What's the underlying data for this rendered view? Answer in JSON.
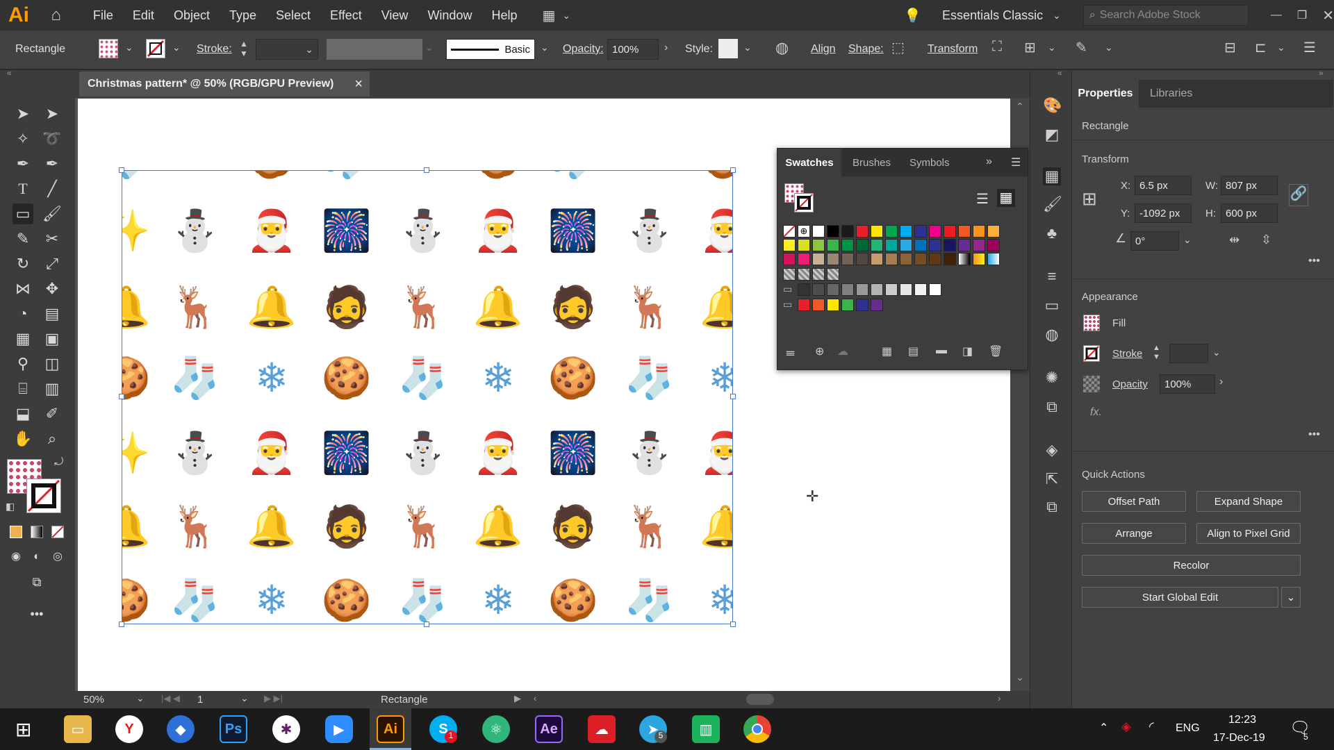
{
  "app": {
    "logo": "Ai"
  },
  "menu": [
    "File",
    "Edit",
    "Object",
    "Type",
    "Select",
    "Effect",
    "View",
    "Window",
    "Help"
  ],
  "workspace": "Essentials Classic",
  "search_placeholder": "Search Adobe Stock",
  "control": {
    "object_type": "Rectangle",
    "stroke_label": "Stroke:",
    "brush": "Basic",
    "opacity_label": "Opacity:",
    "opacity_value": "100%",
    "style_label": "Style:",
    "align": "Align",
    "shape": "Shape:",
    "transform": "Transform"
  },
  "document": {
    "tab_title": "Christmas pattern* @ 50% (RGB/GPU Preview)",
    "close": "×"
  },
  "status": {
    "zoom": "50%",
    "page": "1",
    "tool": "Rectangle"
  },
  "swatches_panel": {
    "tabs": [
      "Swatches",
      "Brushes",
      "Symbols"
    ]
  },
  "properties": {
    "tabs": [
      "Properties",
      "Libraries"
    ],
    "object": "Rectangle",
    "transform_title": "Transform",
    "x_label": "X:",
    "x": "6.5 px",
    "y_label": "Y:",
    "y": "-1092 px",
    "w_label": "W:",
    "w": "807 px",
    "h_label": "H:",
    "h": "600 px",
    "angle": "0°",
    "appearance_title": "Appearance",
    "fill": "Fill",
    "stroke": "Stroke",
    "opacity_label": "Opacity",
    "opacity": "100%",
    "fx": "fx.",
    "quick_actions_title": "Quick Actions",
    "offset_path": "Offset Path",
    "expand_shape": "Expand Shape",
    "arrange": "Arrange",
    "align_pixel": "Align to Pixel Grid",
    "recolor": "Recolor",
    "global_edit": "Start Global Edit"
  },
  "taskbar": {
    "lang": "ENG",
    "time": "12:23",
    "date": "17-Dec-19",
    "notif_count": "5",
    "skype_badge": "1",
    "telegram_badge": "5",
    "apps": [
      "Ps",
      "Ai",
      "Ae"
    ]
  },
  "colors": {
    "accent": "#ff9a00",
    "pink": "#e8567e",
    "lavender": "#c9b9d8",
    "blue": "#5aa0d8",
    "gold": "#f2c15a"
  }
}
